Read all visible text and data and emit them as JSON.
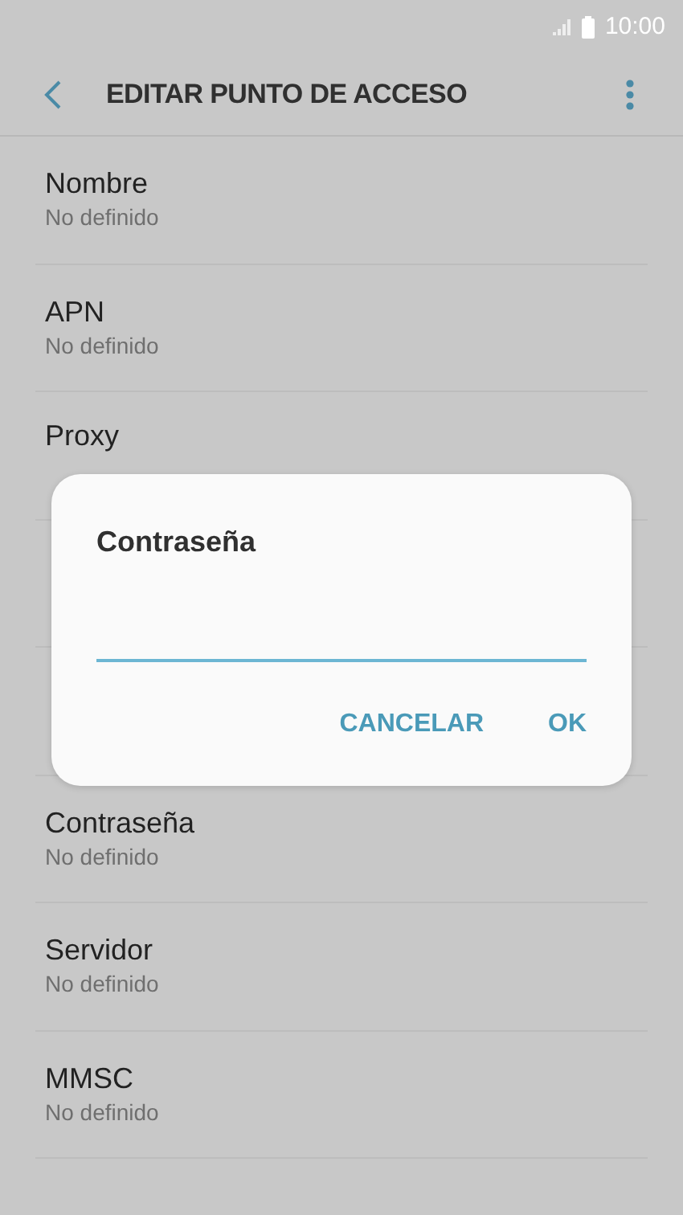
{
  "status_bar": {
    "time": "10:00"
  },
  "toolbar": {
    "title": "EDITAR PUNTO DE ACCESO"
  },
  "settings_above_dialog": [
    {
      "label": "Nombre",
      "value": "No definido"
    },
    {
      "label": "APN",
      "value": "No definido"
    },
    {
      "label": "Proxy"
    }
  ],
  "settings_below_dialog": [
    {
      "label": "Contraseña",
      "value": "No definido"
    },
    {
      "label": "Servidor",
      "value": "No definido"
    },
    {
      "label": "MMSC",
      "value": "No definido"
    }
  ],
  "dialog": {
    "title": "Contraseña",
    "buttons": [
      "CANCELAR",
      "OK"
    ]
  }
}
